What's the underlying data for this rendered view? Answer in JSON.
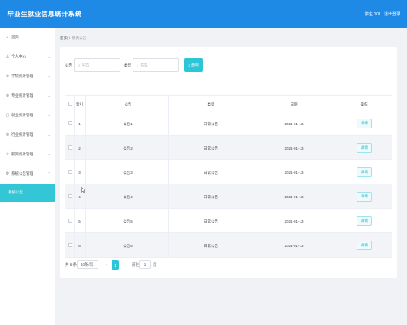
{
  "header": {
    "app_title": "毕业生就业信息统计系统",
    "user_name": "学生 001",
    "logout_label": "退出登录"
  },
  "sidebar": {
    "items": [
      {
        "label": "首页",
        "icon": "home-icon"
      },
      {
        "label": "个人中心",
        "icon": "user-icon"
      },
      {
        "label": "学院统计管理",
        "icon": "grid-icon"
      },
      {
        "label": "专业统计管理",
        "icon": "grid-icon"
      },
      {
        "label": "就业统计管理",
        "icon": "doc-icon"
      },
      {
        "label": "行业统计管理",
        "icon": "grid-icon"
      },
      {
        "label": "薪资统计管理",
        "icon": "trophy-icon"
      },
      {
        "label": "系统公告管理",
        "icon": "settings-icon"
      }
    ],
    "active_sub": "系统公告"
  },
  "breadcrumb": {
    "home": "首页",
    "current": "系统公告"
  },
  "filters": {
    "title_label": "公告",
    "title_placeholder": "公告",
    "type_label": "类型",
    "type_placeholder": "类型",
    "search_label": "查询"
  },
  "table": {
    "columns": [
      "索引",
      "公告",
      "类型",
      "日期",
      "操作"
    ],
    "rows": [
      {
        "index": "1",
        "title": "公告1",
        "type": "日常公告",
        "date": "2021-01-13",
        "action": "详情"
      },
      {
        "index": "2",
        "title": "公告2",
        "type": "日常公告",
        "date": "2021-01-13",
        "action": "详情"
      },
      {
        "index": "3",
        "title": "公告3",
        "type": "日常公告",
        "date": "2021-01-13",
        "action": "详情"
      },
      {
        "index": "4",
        "title": "公告4",
        "type": "日常公告",
        "date": "2021-01-13",
        "action": "详情"
      },
      {
        "index": "5",
        "title": "公告5",
        "type": "日常公告",
        "date": "2021-01-13",
        "action": "详情"
      },
      {
        "index": "6",
        "title": "公告6",
        "type": "日常公告",
        "date": "2021-01-13",
        "action": "详情"
      }
    ]
  },
  "pagination": {
    "total": "共 6 条",
    "page_size": "10条/页",
    "current_page": "1",
    "goto_label": "前往",
    "goto_value": "1",
    "page_unit": "页"
  },
  "colors": {
    "header_bg": "#1f8ae6",
    "accent": "#2cc6d6",
    "active_sidebar": "#33c6d6"
  }
}
